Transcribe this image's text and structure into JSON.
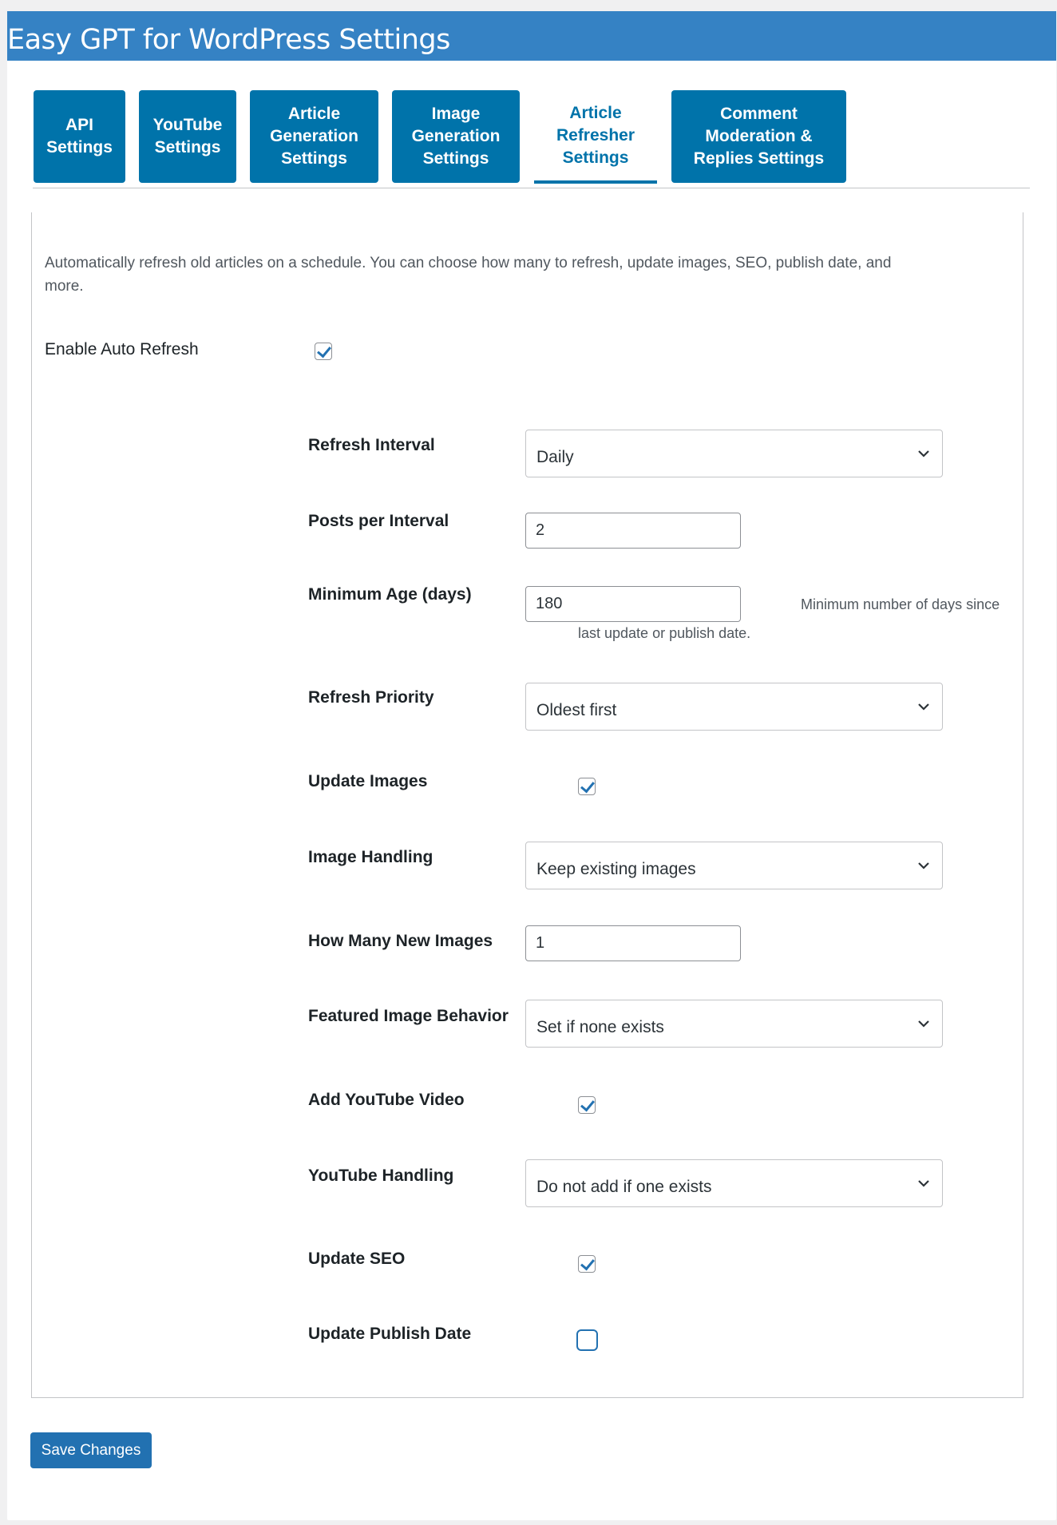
{
  "app": {
    "title": "Easy GPT for WordPress Settings"
  },
  "tabs": [
    {
      "line1": "API",
      "line2": "Settings",
      "line3": ""
    },
    {
      "line1": "YouTube",
      "line2": "Settings",
      "line3": ""
    },
    {
      "line1": "Article",
      "line2": "Generation",
      "line3": "Settings"
    },
    {
      "line1": "Image",
      "line2": "Generation",
      "line3": "Settings"
    },
    {
      "line1": "Article",
      "line2": "Refresher",
      "line3": "Settings",
      "active": true
    },
    {
      "line1": "Comment",
      "line2": "Moderation &",
      "line3": "Replies Settings"
    }
  ],
  "description": "Automatically refresh old articles on a schedule. You can choose how many to refresh, update images, SEO, publish date, and more.",
  "enable_auto_refresh": {
    "label": "Enable Auto Refresh",
    "checked": true
  },
  "fields": {
    "refresh_interval": {
      "label": "Refresh Interval",
      "value": "Daily"
    },
    "posts_per_interval": {
      "label": "Posts per Interval",
      "value": "2"
    },
    "minimum_age": {
      "label": "Minimum Age (days)",
      "value": "180",
      "help_part1": "Minimum number of days since",
      "help_part2": "last update or publish date."
    },
    "refresh_priority": {
      "label": "Refresh Priority",
      "value": "Oldest first"
    },
    "update_images": {
      "label": "Update Images",
      "checked": true
    },
    "image_handling": {
      "label": "Image Handling",
      "value": "Keep existing images"
    },
    "how_many_new_images": {
      "label": "How Many New Images",
      "value": "1"
    },
    "featured_image_behavior": {
      "label": "Featured Image Behavior",
      "value": "Set if none exists"
    },
    "add_youtube_video": {
      "label": "Add YouTube Video",
      "checked": true
    },
    "youtube_handling": {
      "label": "YouTube Handling",
      "value": "Do not add if one exists"
    },
    "update_seo": {
      "label": "Update SEO",
      "checked": true
    },
    "update_publish_date": {
      "label": "Update Publish Date",
      "checked": false
    }
  },
  "save_button": "Save Changes",
  "icons": {
    "checkmark": "checkmark-icon",
    "chevron": "chevron-down-icon"
  },
  "colors": {
    "header_bg": "#3582c4",
    "tab_bg": "#0073aa",
    "accent": "#2271b1"
  }
}
